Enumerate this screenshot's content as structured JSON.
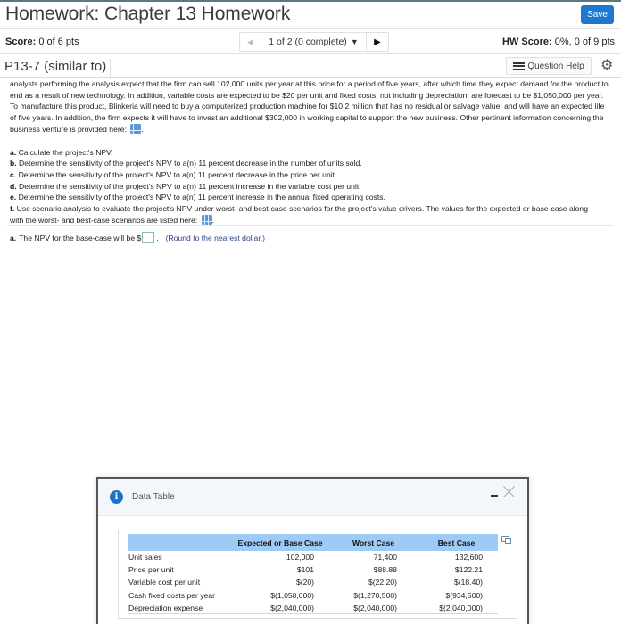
{
  "header": {
    "title": "Homework: Chapter 13 Homework",
    "save_label": "Save"
  },
  "scorebar": {
    "score_label": "Score:",
    "score_value": "0 of 6 pts",
    "pager_text": "1 of 2 (0 complete)",
    "hw_score_label": "HW Score:",
    "hw_score_value": "0%, 0 of 9 pts"
  },
  "question": {
    "id": "P13-7 (similar to)",
    "help_label": "Question Help",
    "paragraph": "analysts performing the analysis expect that the firm can sell 102,000 units per year at this price for a period of five years, after which time they expect demand for the product to end as a result of new technology.  In addition, variable costs are expected to be $20 per unit and fixed costs, not including depreciation, are forecast to be $1,050,000 per year.  To manufacture this product, Blinkeria will need to buy a computerized production machine for $10.2 million that has no residual or salvage value, and will have an expected life of five years.  In addition, the firm expects it will have to invest an additional $302,000 in working capital to support the new business.  Other pertinent information concerning the business venture is provided here:",
    "tasks": [
      {
        "letter": "a.",
        "text": "Calculate the project's NPV."
      },
      {
        "letter": "b.",
        "text": "Determine the sensitivity of the project's NPV to a(n) 11 percent decrease in the number of units sold."
      },
      {
        "letter": "c.",
        "text": "Determine the sensitivity of the project's NPV to a(n) 11 percent decrease in the price per unit."
      },
      {
        "letter": "d.",
        "text": "Determine the sensitivity of the project's NPV to a(n) 11 percent increase in the variable cost per unit."
      },
      {
        "letter": "e.",
        "text": "Determine the sensitivity of the project's NPV to a(n) 11 percent increase in the annual fixed operating costs."
      },
      {
        "letter": "f.",
        "text": "Use scenario analysis to evaluate the project's NPV under worst- and best-case scenarios for the project's value drivers.  The values for the expected or base-case along with the worst- and best-case scenarios are listed here:"
      }
    ]
  },
  "answer": {
    "letter": "a.",
    "prompt": "The NPV for the base-case will be $",
    "value": "",
    "hint": "(Round to the nearest dollar.)"
  },
  "modal": {
    "title": "Data Table",
    "columns": [
      "",
      "Expected or Base Case",
      "Worst Case",
      "Best Case"
    ],
    "rows": [
      {
        "label": "Unit sales",
        "base": "102,000",
        "worst": "71,400",
        "best": "132,600"
      },
      {
        "label": "Price per unit",
        "base": "$101",
        "worst": "$88.88",
        "best": "$122.21"
      },
      {
        "label": "Variable cost per unit",
        "base": "$(20)",
        "worst": "$(22.20)",
        "best": "$(18.40)"
      },
      {
        "label": "Cash fixed costs per year",
        "base": "$(1,050,000)",
        "worst": "$(1,270,500)",
        "best": "$(934,500)"
      },
      {
        "label": "Depreciation expense",
        "base": "$(2,040,000)",
        "worst": "$(2,040,000)",
        "best": "$(2,040,000)"
      }
    ]
  },
  "colors": {
    "save_button": "#1e78d2",
    "table_header": "#9ecbf6",
    "info_icon": "#1a73c8",
    "hint_text": "#2a3e8c"
  }
}
